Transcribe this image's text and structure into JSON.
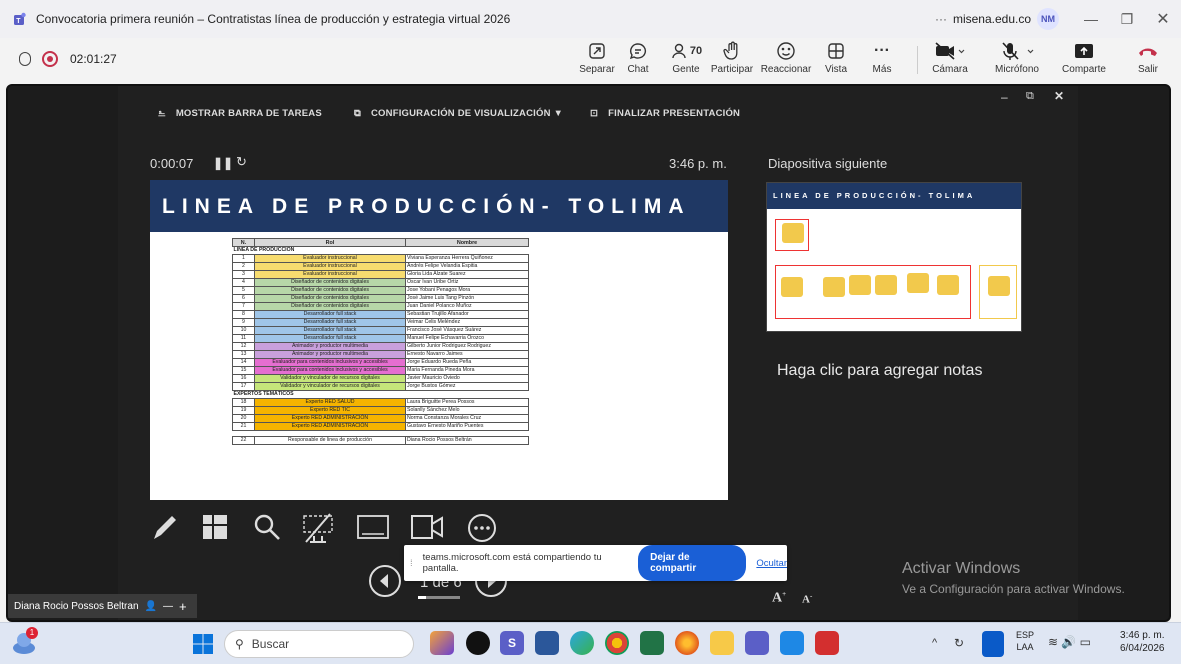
{
  "window": {
    "title": "Convocatoria primera reunión – Contratistas línea de producción y estrategia virtual 2026",
    "domain": "misena.edu.co",
    "avatar": "NM",
    "more": "···"
  },
  "meeting": {
    "timer": "02:01:27",
    "buttons": [
      {
        "label": "Separar",
        "icon": "pop-out-icon"
      },
      {
        "label": "Chat",
        "icon": "chat-icon"
      },
      {
        "label": "Gente",
        "icon": "people-icon",
        "count": "70"
      },
      {
        "label": "Participar",
        "icon": "raise-hand-icon"
      },
      {
        "label": "Reaccionar",
        "icon": "emoji-icon"
      },
      {
        "label": "Vista",
        "icon": "view-icon"
      },
      {
        "label": "Más",
        "icon": "more-icon"
      },
      {
        "label": "Cámara",
        "icon": "camera-off-icon"
      },
      {
        "label": "Micrófono",
        "icon": "mic-off-icon"
      },
      {
        "label": "Comparte",
        "icon": "share-icon"
      },
      {
        "label": "Salir",
        "icon": "leave-icon"
      }
    ]
  },
  "presenter": {
    "toolbar": [
      "MOSTRAR BARRA DE TAREAS",
      "CONFIGURACIÓN DE VISUALIZACIÓN ▼",
      "FINALIZAR PRESENTACIÓN"
    ],
    "elapsed": "0:00:07",
    "clock": "3:46 p. m.",
    "next_label": "Diapositiva siguiente",
    "notes": "Haga clic para agregar notas",
    "page": "1 de 6",
    "slide_title": "LINEA DE PRODUCCIÓN- TOLIMA",
    "table_head": [
      "N.",
      "Rol",
      "Nombre"
    ],
    "sections": {
      "a": "LINEA DE PRODUCCION",
      "b": "EXPERTOS TEMÁTICOS"
    },
    "rows": [
      [
        "1",
        "Evaluador instruccional",
        "Viviana Esperanza Herrera Quiñonez",
        "#f7dc6f"
      ],
      [
        "2",
        "Evaluador instruccional",
        "Andrés Felipe Velandia Espitia",
        "#f7dc6f"
      ],
      [
        "3",
        "Evaluador instruccional",
        "Gloria Lida Alzate Suarez",
        "#f7dc6f"
      ],
      [
        "4",
        "Diseñador de contenidos digitales",
        "Oscar Ivan Uribe Ortiz",
        "#b7d7a8"
      ],
      [
        "5",
        "Diseñador de contenidos digitales",
        "Jose Yobani Penagos Mora",
        "#b7d7a8"
      ],
      [
        "6",
        "Diseñador de contenidos digitales",
        "José Jaime Luis Tang Pinzón",
        "#b7d7a8"
      ],
      [
        "7",
        "Diseñador de contenidos digitales",
        "Juan Daniel Polanco Muñoz",
        "#b7d7a8"
      ],
      [
        "8",
        "Desarrollador full stack",
        "Sebastian Trujillo Afanador",
        "#9fc5e8"
      ],
      [
        "9",
        "Desarrollador full stack",
        "Veimar Celis Meléndez",
        "#9fc5e8"
      ],
      [
        "10",
        "Desarrollador full stack",
        "Francisco José Vásquez Suárez",
        "#9fc5e8"
      ],
      [
        "11",
        "Desarrollador full stack",
        "Manuel Felipe Echavarria Orozco",
        "#9fc5e8"
      ],
      [
        "12",
        "Animador y productor multimedia",
        "Gilberto Junior Rodriguez Rodriguez",
        "#c9a0dc"
      ],
      [
        "13",
        "Animador y productor multimedia",
        "Ernesto Navarro Jaimes",
        "#c9a0dc"
      ],
      [
        "14",
        "Evaluador para contenidos inclusivos y accesibles",
        "Jorge Eduardo Rueda Peña",
        "#e56ed0"
      ],
      [
        "15",
        "Evaluador para contenidos inclusivos y accesibles",
        "Maria Fernanda Pineda Mora",
        "#e56ed0"
      ],
      [
        "16",
        "Validador y vinculador de recursos digitales",
        "Javier Mauricio Oviedo",
        "#c5e57a"
      ],
      [
        "17",
        "Validador y vinculador de recursos digitales",
        "Jorge Bustos Gómez",
        "#c5e57a"
      ]
    ],
    "rows2": [
      [
        "18",
        "Experto RED SALUD",
        "Laura Briguitte Perea Possos",
        "#f5b400"
      ],
      [
        "19",
        "Experto RED TIC",
        "Solanlly Sánchez Melo",
        "#f5b400"
      ],
      [
        "20",
        "Experto RED ADMINISTRACIÓN",
        "Norma Constanza Morales Cruz",
        "#f5b400"
      ],
      [
        "21",
        "Experto RED ADMINISTRACIÓN",
        "Gustavo Ernesto Mariño Puentes",
        "#f5b400"
      ]
    ],
    "row_last": [
      "22",
      "Responsable de linea de producción",
      "Diana Rocio Possos Beltrán"
    ]
  },
  "toast": {
    "text": "teams.microsoft.com está compartiendo tu pantalla.",
    "stop": "Dejar de compartir",
    "hide": "Ocultar"
  },
  "participant": "Diana Rocio Possos Beltran",
  "watermark": {
    "l1": "Activar Windows",
    "l2": "Ve a Configuración para activar Windows."
  },
  "taskbar": {
    "search": "Buscar",
    "lang1": "ESP",
    "lang2": "LAA",
    "time": "3:46 p. m.",
    "date": "6/04/2026",
    "badge": "1"
  }
}
